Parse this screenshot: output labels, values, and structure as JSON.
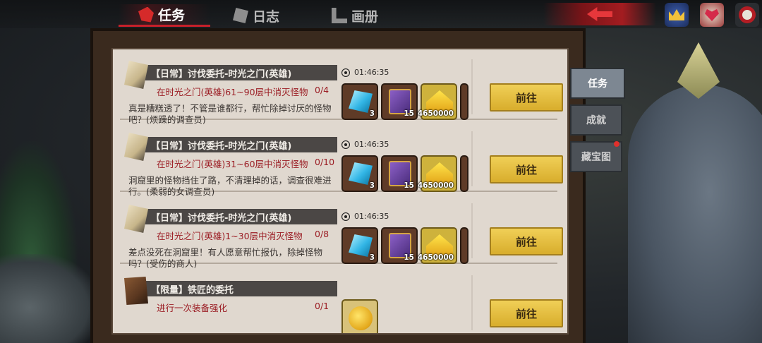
{
  "tabs": [
    {
      "label": "任务",
      "active": true
    },
    {
      "label": "日志",
      "active": false
    },
    {
      "label": "画册",
      "active": false
    }
  ],
  "side_tabs": [
    {
      "label": "任务",
      "active": true
    },
    {
      "label": "成就",
      "active": false
    },
    {
      "label": "藏宝图",
      "active": false,
      "badge": true
    }
  ],
  "quests": [
    {
      "title": "【日常】讨伐委托-时光之门(英雄)",
      "target": "在时光之门(英雄)61~90层中消灭怪物",
      "progress": "0/4",
      "desc": "真是糟糕透了！不管是谁都行，帮忙除掉讨厌的怪物吧？(烦躁的调查员)",
      "timer": "01:46:35",
      "rewards": [
        {
          "icon": "crystal-icon",
          "qty": "3"
        },
        {
          "icon": "tome-icon",
          "qty": "15"
        },
        {
          "icon": "gold-pile-icon",
          "qty": "4650000"
        }
      ],
      "button": "前往"
    },
    {
      "title": "【日常】讨伐委托-时光之门(英雄)",
      "target": "在时光之门(英雄)31~60层中消灭怪物",
      "progress": "0/10",
      "desc": "洞窟里的怪物挡住了路，不清理掉的话，调查很难进行。(柔弱的女调查员)",
      "timer": "01:46:35",
      "rewards": [
        {
          "icon": "crystal-icon",
          "qty": "3"
        },
        {
          "icon": "tome-icon",
          "qty": "15"
        },
        {
          "icon": "gold-pile-icon",
          "qty": "4650000"
        }
      ],
      "button": "前往"
    },
    {
      "title": "【日常】讨伐委托-时光之门(英雄)",
      "target": "在时光之门(英雄)1~30层中消灭怪物",
      "progress": "0/8",
      "desc": "差点没死在洞窟里！有人愿意帮忙报仇，除掉怪物吗？(受伤的商人)",
      "timer": "01:46:35",
      "rewards": [
        {
          "icon": "crystal-icon",
          "qty": "3"
        },
        {
          "icon": "tome-icon",
          "qty": "15"
        },
        {
          "icon": "gold-pile-icon",
          "qty": "4650000"
        }
      ],
      "button": "前往"
    },
    {
      "title": "【限量】铁匠的委托",
      "target": "进行一次装备强化",
      "progress": "0/1",
      "desc": "",
      "timer": "",
      "rewards": [
        {
          "icon": "gold-coin-icon",
          "qty": ""
        }
      ],
      "button": "前往"
    }
  ]
}
